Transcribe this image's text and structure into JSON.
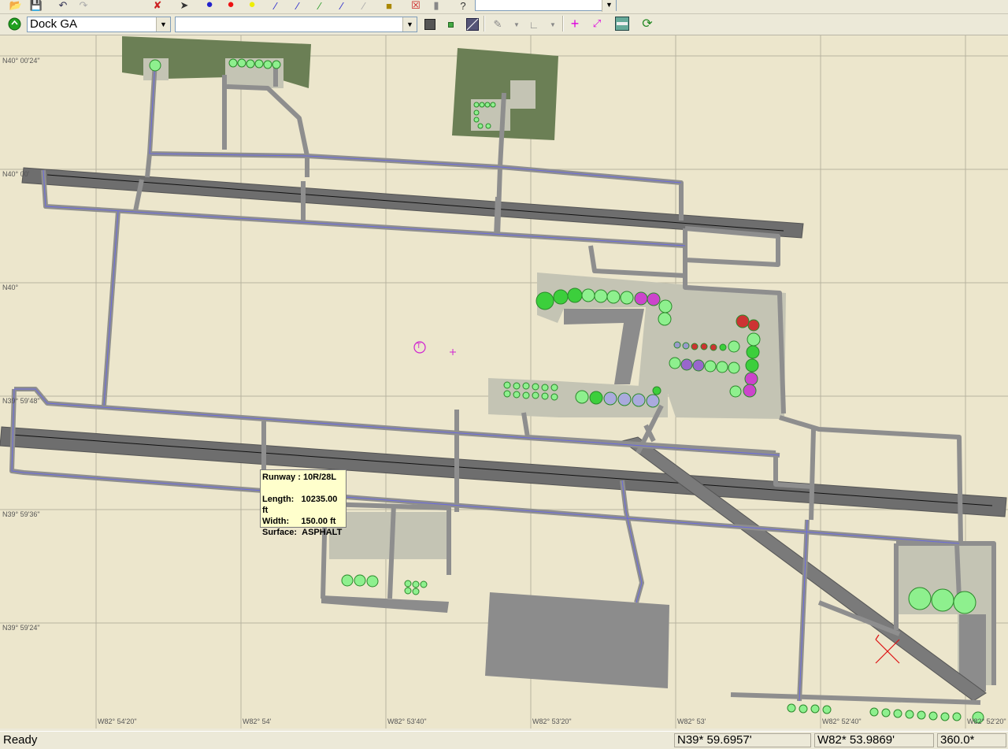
{
  "toolbar1": {
    "layer_combo_value": ""
  },
  "toolbar2": {
    "group_combo_value": "Dock GA",
    "object_combo_value": ""
  },
  "map": {
    "lat_labels": [
      "N40° 00'24\"",
      "N40° 00'",
      "N40°",
      "N39° 59'48\"",
      "N39° 59'36\"",
      "N39° 59'24\""
    ],
    "lon_labels": [
      "W82° 54'20\"",
      "W82° 54'",
      "W82° 53'40\"",
      "W82° 53'20\"",
      "W82° 53'",
      "W82° 52'40\"",
      "W82° 52'20\""
    ],
    "tower_label": "T"
  },
  "tooltip": {
    "title": "Runway : 10R/28L",
    "length_label": "Length:",
    "length_value": "10235.00 ft",
    "width_label": "Width:",
    "width_value": "150.00 ft",
    "surface_label": "Surface:",
    "surface_value": "ASPHALT"
  },
  "status": {
    "state": "Ready",
    "lat": "N39* 59.6957'",
    "lon": "W82* 53.9869'",
    "heading": "360.0*"
  },
  "colors": {
    "ground": "#ece6cc",
    "taxiway": "#8c8c8c",
    "apron": "#c8c8b8",
    "grass": "#667a50",
    "parking_green": "#7ee87e",
    "parking_magenta": "#cc44cc",
    "parking_red": "#cc3333"
  }
}
